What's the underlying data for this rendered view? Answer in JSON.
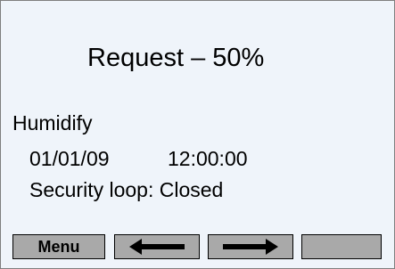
{
  "display": {
    "title": "Request – 50%",
    "mode": "Humidify",
    "date": "01/01/09",
    "time": "12:00:00",
    "security_status": "Security loop: Closed"
  },
  "softkeys": {
    "menu_label": "Menu",
    "back_icon": "left-arrow-icon",
    "next_icon": "right-arrow-icon",
    "blank_label": ""
  },
  "colors": {
    "screen_background": "#eff4fa",
    "key_background": "#a9a9a9",
    "text": "#000000"
  }
}
